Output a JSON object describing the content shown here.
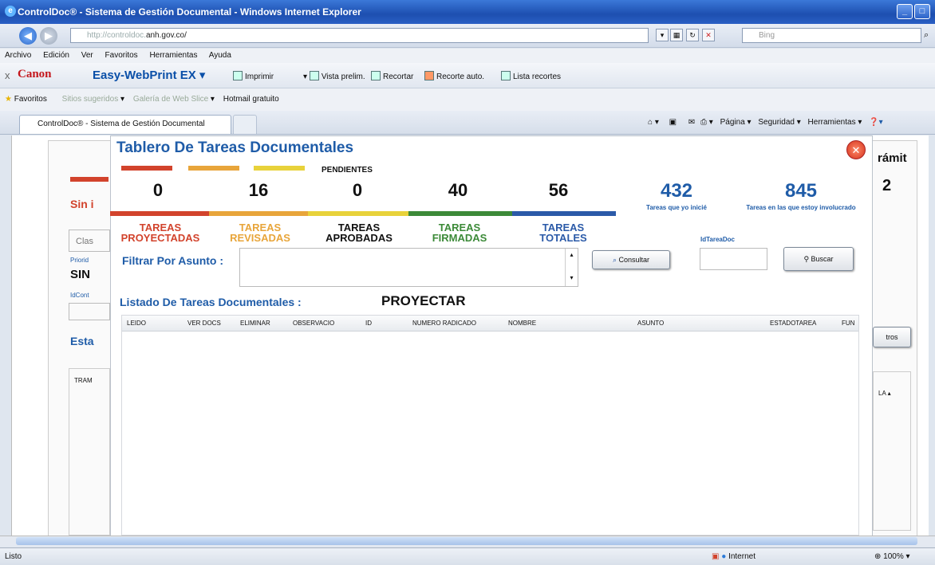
{
  "window": {
    "title": "ControlDoc® - Sistema de Gestión Documental - Windows Internet Explorer"
  },
  "address": {
    "url_prefix": "http://controldoc.",
    "url_domain": "anh.gov.co/",
    "search_placeholder": "Bing"
  },
  "menu": [
    "Archivo",
    "Edición",
    "Ver",
    "Favoritos",
    "Herramientas",
    "Ayuda"
  ],
  "canon": {
    "brand": "Canon",
    "product": "Easy-WebPrint EX",
    "buttons": [
      "Imprimir",
      "Vista prelim.",
      "Recortar",
      "Recorte auto.",
      "Lista recortes"
    ]
  },
  "favorites": {
    "label": "Favoritos",
    "items": [
      "Sitios sugeridos",
      "Galería de Web Slice",
      "Hotmail gratuito"
    ]
  },
  "tab": {
    "title": "ControlDoc® - Sistema de Gestión Documental"
  },
  "command_bar": [
    "Página",
    "Seguridad",
    "Herramientas"
  ],
  "background": {
    "sin": "Sin i",
    "clas": "Clas",
    "priorid": "Priorid",
    "sin_val": "SIN",
    "idcont": "IdCont",
    "esta": "Esta",
    "tram": "TRAM",
    "tramit": "rámit",
    "two": "2",
    "tros": "tros",
    "la": "LA"
  },
  "modal": {
    "title": "Tablero De Tareas Documentales",
    "pendientes": "PENDIENTES",
    "counters": [
      {
        "value": "0",
        "label1": "TAREAS",
        "label2": "PROYECTADAS",
        "color": "#d2432c"
      },
      {
        "value": "16",
        "label1": "TAREAS",
        "label2": "REVISADAS",
        "color": "#e8a53a"
      },
      {
        "value": "0",
        "label1": "TAREAS",
        "label2": "APROBADAS",
        "color": "#e8d23a"
      },
      {
        "value": "40",
        "label1": "TAREAS",
        "label2": "FIRMADAS",
        "color": "#3c8a38"
      },
      {
        "value": "56",
        "label1": "TAREAS",
        "label2": "TOTALES",
        "color": "#2b5aa8"
      }
    ],
    "stat_iniciadas": {
      "value": "432",
      "label": "Tareas que yo inicié"
    },
    "stat_involucrado": {
      "value": "845",
      "label": "Tareas en las que estoy involucrado"
    },
    "filter_label": "Filtrar Por Asunto :",
    "consultar": "Consultar",
    "id_label": "IdTareaDoc",
    "buscar": "Buscar",
    "list_label": "Listado De Tareas Documentales :",
    "list_state": "PROYECTAR",
    "columns": [
      "LEIDO",
      "VER DOCS",
      "ELIMINAR",
      "OBSERVACIO",
      "ID",
      "NUMERO RADICADO",
      "NOMBRE",
      "ASUNTO",
      "ESTADOTAREA",
      "FUN"
    ]
  },
  "status": {
    "left": "Listo",
    "zone": "Internet",
    "zoom": "100%"
  }
}
